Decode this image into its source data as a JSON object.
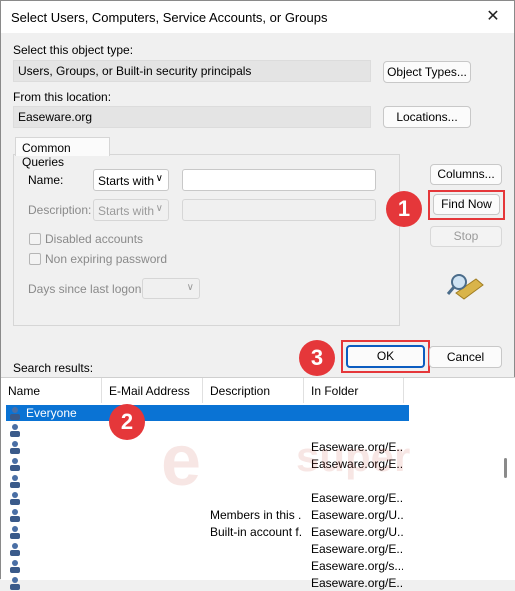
{
  "window": {
    "title": "Select Users, Computers, Service Accounts, or Groups",
    "close_glyph": "✕"
  },
  "object_type": {
    "label": "Select this object type:",
    "value": "Users, Groups, or Built-in security principals",
    "button": "Object Types..."
  },
  "location": {
    "label": "From this location:",
    "value": "Easeware.org",
    "button": "Locations..."
  },
  "queries": {
    "tab": "Common Queries",
    "name_label": "Name:",
    "name_mode": "Starts with",
    "name_value": "",
    "description_label": "Description:",
    "description_mode": "Starts with",
    "disabled_accounts": "Disabled accounts",
    "non_expiring": "Non expiring password",
    "days_label": "Days since last logon:",
    "days_value": ""
  },
  "buttons": {
    "columns": "Columns...",
    "find_now": "Find Now",
    "stop": "Stop",
    "ok": "OK",
    "cancel": "Cancel"
  },
  "markers": {
    "m1": "1",
    "m2": "2",
    "m3": "3"
  },
  "results": {
    "label": "Search results:",
    "columns": [
      "Name",
      "E-Mail Address",
      "Description",
      "In Folder"
    ],
    "rows": [
      {
        "name": "Everyone",
        "email": "",
        "description": "",
        "folder": ""
      },
      {
        "name": "",
        "email": "",
        "description": "",
        "folder": ""
      },
      {
        "name": "",
        "email": "",
        "description": "",
        "folder": "Easeware.org/E..."
      },
      {
        "name": "",
        "email": "",
        "description": "",
        "folder": "Easeware.org/E..."
      },
      {
        "name": "",
        "email": "",
        "description": "",
        "folder": ""
      },
      {
        "name": "",
        "email": "",
        "description": "",
        "folder": "Easeware.org/E..."
      },
      {
        "name": "",
        "email": "",
        "description": "Members in this ...",
        "folder": "Easeware.org/U..."
      },
      {
        "name": "",
        "email": "",
        "description": "Built-in account f...",
        "folder": "Easeware.org/U..."
      },
      {
        "name": "",
        "email": "",
        "description": "",
        "folder": "Easeware.org/E..."
      },
      {
        "name": "",
        "email": "",
        "description": "",
        "folder": "Easeware.org/s..."
      },
      {
        "name": "",
        "email": "",
        "description": "",
        "folder": "Easeware.org/E..."
      }
    ]
  },
  "colors": {
    "marker": "#e5373a",
    "selection": "#0a73d4"
  }
}
